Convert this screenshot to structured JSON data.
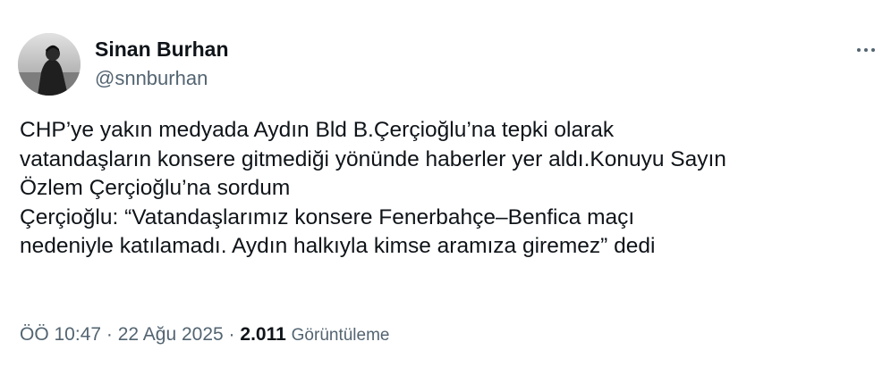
{
  "author": {
    "name": "Sinan Burhan",
    "handle": "@snnburhan"
  },
  "tweet": {
    "lines": [
      "CHP’ye yakın medyada Aydın Bld B.Çerçioğlu’na tepki olarak",
      "vatandaşların konsere gitmediği yönünde haberler yer aldı.Konuyu Sayın",
      "Özlem Çerçioğlu’na sordum",
      "Çerçioğlu: “Vatandaşlarımız konsere Fenerbahçe–Benfica maçı",
      "nedeniyle katılamadı. Aydın halkıyla kimse aramıza giremez” dedi"
    ]
  },
  "meta": {
    "time": "ÖÖ 10:47",
    "separator": "·",
    "date": "22 Ağu 2025",
    "views_count": "2.011",
    "views_label": "Görüntüleme"
  },
  "icons": {
    "more": "more-horizontal-icon"
  },
  "colors": {
    "text": "#0f1419",
    "secondary": "#536471",
    "background": "#ffffff"
  }
}
